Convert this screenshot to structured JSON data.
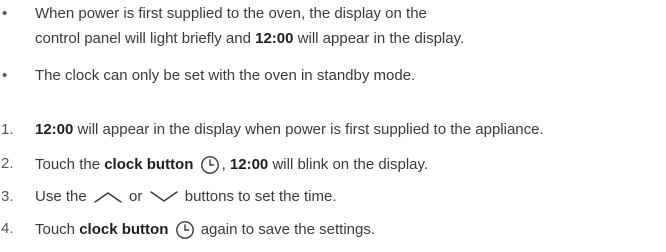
{
  "bullets": [
    {
      "marker": "•",
      "line1": "When power is first supplied to the oven, the display on the",
      "line2_pre": "control panel will light briefly and ",
      "line2_bold": "12:00",
      "line2_post": " will appear in the display."
    },
    {
      "marker": "•",
      "text": "The clock can only be set with the oven in standby mode."
    }
  ],
  "steps": [
    {
      "num": "1.",
      "bold": "12:00",
      "text": " will appear in the display when power is first supplied to the appliance."
    },
    {
      "num": "2.",
      "pre": "Touch the ",
      "bold": "clock button",
      "icon": "clock-icon",
      "sep": ", ",
      "bold2": "12:00",
      "post": " will blink on the display."
    },
    {
      "num": "3.",
      "pre": "Use the ",
      "icon_up": "chevron-up-icon",
      "mid": " or ",
      "icon_down": "chevron-down-icon",
      "post": " buttons to set the time."
    },
    {
      "num": "4.",
      "pre": "Touch ",
      "bold": "clock button",
      "icon": "clock-icon",
      "post": " again to save the settings."
    }
  ]
}
